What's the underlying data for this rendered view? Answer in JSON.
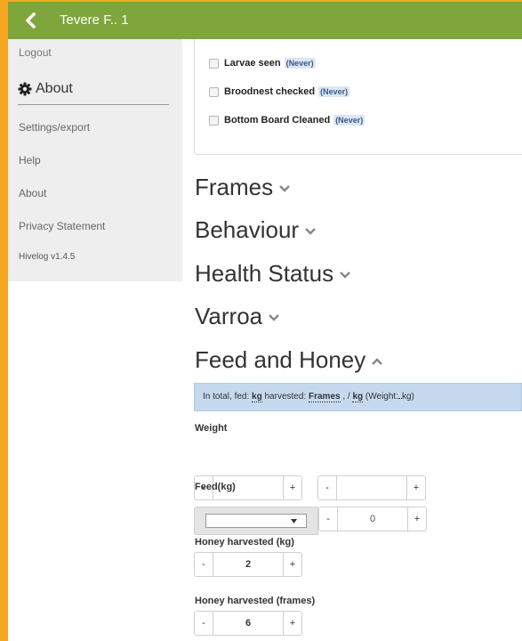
{
  "header": {
    "title": "Tevere F.. 1"
  },
  "sidebar": {
    "logout": "Logout",
    "about_heading": "About",
    "links": [
      "Settings/export",
      "Help",
      "About",
      "Privacy Statement"
    ],
    "version": "Hivelog v1.4.5"
  },
  "checklist": [
    {
      "label": "Larvae seen",
      "badge": "(Never)"
    },
    {
      "label": "Broodnest checked",
      "badge": "(Never)"
    },
    {
      "label": "Bottom Board Cleaned",
      "badge": "(Never)"
    }
  ],
  "sections": [
    {
      "title": "Frames",
      "expanded": false
    },
    {
      "title": "Behaviour",
      "expanded": false
    },
    {
      "title": "Health Status",
      "expanded": false
    },
    {
      "title": "Varroa",
      "expanded": false
    },
    {
      "title": "Feed and Honey",
      "expanded": true
    }
  ],
  "summary": {
    "t1": "In total, fed:",
    "kg1": "kg",
    "t2": "harvested:",
    "frames": "Frames",
    "t3": ", /",
    "kg2": "kg",
    "t4": "(Weight:",
    "kg3": "kg)"
  },
  "weight": {
    "label": "Weight",
    "minus": "-",
    "plus": "+",
    "value1": "",
    "value2": ""
  },
  "feed": {
    "label": "Feed(kg)",
    "selected": "",
    "minus": "-",
    "plus": "+",
    "value": "0"
  },
  "honey_kg": {
    "label": "Honey harvested (kg)",
    "minus": "-",
    "plus": "+",
    "value": "2"
  },
  "honey_frames": {
    "label": "Honey harvested (frames)",
    "minus": "-",
    "plus": "+",
    "value": "6"
  },
  "colors": {
    "topbar": "#7fa53d",
    "accent_border": "#f5a623",
    "summary_bg": "#c6d9ef",
    "sidebar_bg": "#eeeeee"
  }
}
